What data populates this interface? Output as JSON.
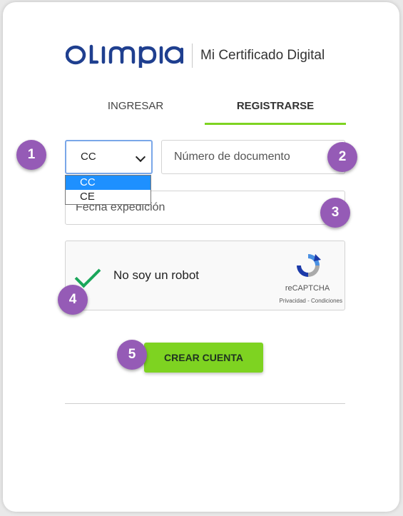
{
  "brand": {
    "logo_text": "OLIMPIA",
    "tagline": "Mi Certificado Digital",
    "color": "#1f3f8f"
  },
  "tabs": [
    {
      "label": "INGRESAR",
      "active": false
    },
    {
      "label": "REGISTRARSE",
      "active": true
    }
  ],
  "accent_color": "#7ed321",
  "form": {
    "doc_type": {
      "selected": "CC",
      "options": [
        "CC",
        "CE"
      ],
      "highlighted_option": "CC"
    },
    "doc_number_placeholder": "Número de documento",
    "date_placeholder": "Fecha expedición",
    "captcha": {
      "label": "No soy un robot",
      "checked": true,
      "brand": "reCAPTCHA",
      "links": "Privacidad - Condiciones"
    },
    "submit_label": "CREAR CUENTA"
  },
  "step_badges": [
    "1",
    "2",
    "3",
    "4",
    "5"
  ],
  "badge_color": "#955bb6"
}
